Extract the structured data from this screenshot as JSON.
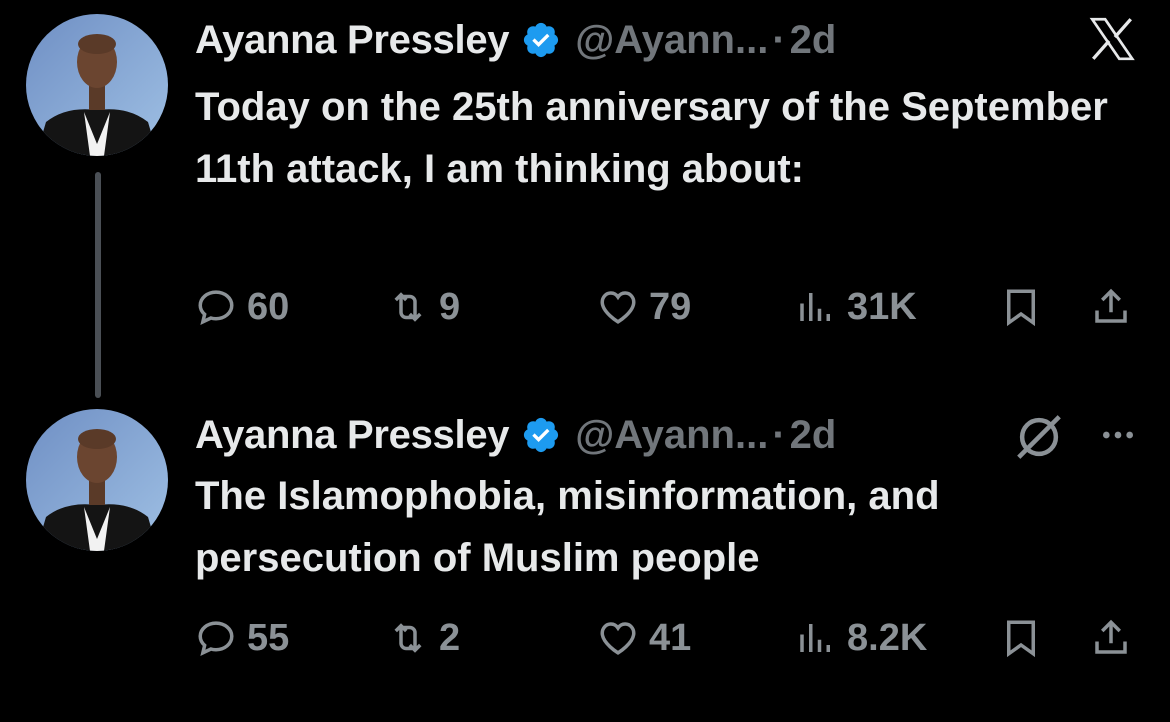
{
  "tweets": [
    {
      "name": "Ayanna Pressley",
      "handle": "@Ayann...",
      "sep": "·",
      "time": "2d",
      "text": "Today on the 25th anniversary of the September 11th attack, I am thinking about:",
      "replies": "60",
      "reposts": "9",
      "likes": "79",
      "views": "31K"
    },
    {
      "name": "Ayanna Pressley",
      "handle": "@Ayann...",
      "sep": "·",
      "time": "2d",
      "text": "The Islamophobia, misinformation, and persecution of Muslim people",
      "replies": "55",
      "reposts": "2",
      "likes": "41",
      "views": "8.2K"
    }
  ],
  "colors": {
    "background": "#000000",
    "text": "#e7e9ea",
    "muted": "#71767b",
    "verified": "#1d9bf0",
    "thread_line": "#4a4f55"
  },
  "icons": {
    "close": "x-logo-icon",
    "verified": "verified-badge-icon",
    "reply": "reply-icon",
    "repost": "repost-icon",
    "like": "heart-icon",
    "views": "views-icon",
    "bookmark": "bookmark-icon",
    "share": "share-icon",
    "grok": "grok-icon",
    "more": "more-icon"
  }
}
